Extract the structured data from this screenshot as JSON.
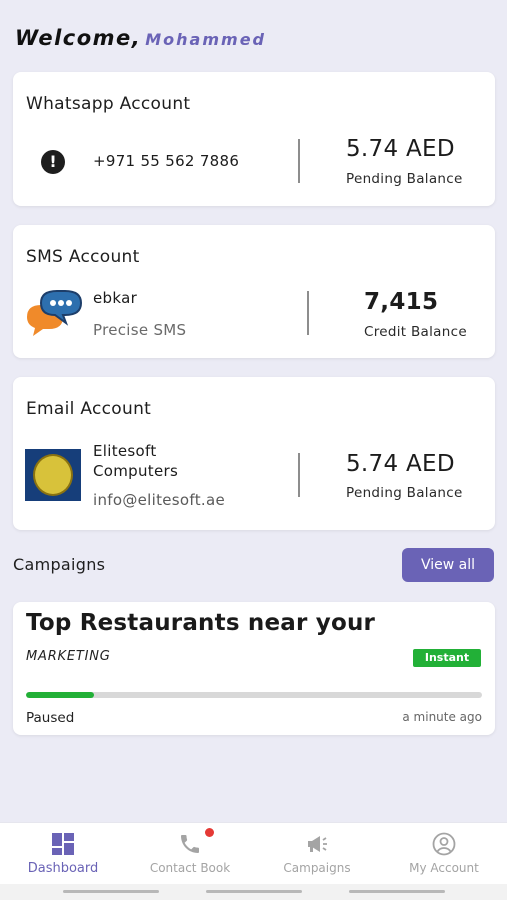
{
  "header": {
    "welcome": "Welcome,",
    "user_name": "Mohammed"
  },
  "whatsapp": {
    "title": "Whatsapp Account",
    "icon": "alert-circle-icon",
    "phone": "+971 55 562 7886",
    "amount": "5.74 AED",
    "amount_label": "Pending Balance"
  },
  "sms": {
    "title": "SMS Account",
    "icon": "chat-bubbles-icon",
    "sender": "ebkar",
    "provider": "Precise SMS",
    "amount": "7,415",
    "amount_label": "Credit Balance"
  },
  "email": {
    "title": "Email Account",
    "logo": "company-logo",
    "company": "Elitesoft Computers",
    "address": "info@elitesoft.ae",
    "amount": "5.74 AED",
    "amount_label": "Pending Balance"
  },
  "campaigns": {
    "section_title": "Campaigns",
    "view_all_label": "View all",
    "items": [
      {
        "title": "Top Restaurants near your",
        "category": "MARKETING",
        "badge": "Instant",
        "progress": 0.15,
        "status": "Paused",
        "time": "a minute ago"
      }
    ]
  },
  "nav": {
    "items": [
      {
        "label": "Dashboard",
        "icon": "dashboard-grid-icon",
        "active": true
      },
      {
        "label": "Contact Book",
        "icon": "phone-icon",
        "active": false,
        "notification_dot": true
      },
      {
        "label": "Campaigns",
        "icon": "megaphone-icon",
        "active": false
      },
      {
        "label": "My Account",
        "icon": "account-circle-icon",
        "active": false
      }
    ]
  },
  "colors": {
    "accent": "#6a63b6",
    "success": "#22b037",
    "background": "#ebebf5",
    "notification": "#e53935"
  }
}
